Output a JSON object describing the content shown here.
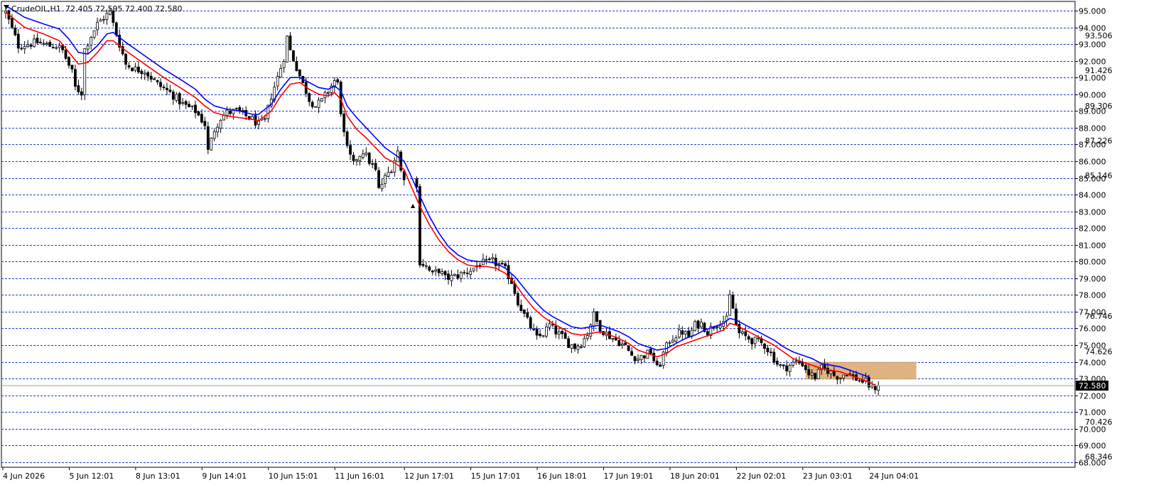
{
  "header": {
    "symbol_label": "CrudeOIL,H1",
    "ohlc_text": "72.405 72.595 72.400 72.580"
  },
  "current_price": {
    "value": 72.58,
    "label": "72.580"
  },
  "colors": {
    "background": "#ffffff",
    "grid": "#1f3fbf",
    "candle": "#000000",
    "ema_fast": "#ff0000",
    "ema_slow": "#0000ff",
    "zone_fill": "#d9a46b",
    "price_line": "#a0a0a0"
  },
  "chart_data": {
    "type": "candlestick",
    "symbol": "CrudeOIL",
    "timeframe": "H1",
    "y_axis": {
      "min": 67.7,
      "max": 95.55,
      "major_ticks": [
        95.0,
        94.0,
        93.0,
        92.0,
        91.0,
        90.0,
        89.0,
        88.0,
        87.0,
        86.0,
        85.0,
        84.0,
        83.0,
        82.0,
        81.0,
        80.0,
        79.0,
        78.0,
        77.0,
        76.0,
        75.0,
        74.0,
        73.0,
        72.0,
        71.0,
        70.0,
        69.0,
        68.0
      ],
      "major_labels": [
        "95.000",
        "94.000",
        "93.000",
        "92.000",
        "91.000",
        "90.000",
        "89.000",
        "88.000",
        "87.000",
        "86.000",
        "85.000",
        "84.000",
        "83.000",
        "82.000",
        "81.000",
        "80.000",
        "79.000",
        "78.000",
        "77.000",
        "76.000",
        "75.000",
        "74.000",
        "73.000",
        "72.000",
        "71.000",
        "70.000",
        "69.000",
        "68.000"
      ],
      "minor_labels": [
        {
          "value": 93.506,
          "label": "93.506"
        },
        {
          "value": 91.426,
          "label": "91.426"
        },
        {
          "value": 89.306,
          "label": "89.306"
        },
        {
          "value": 87.226,
          "label": "87.226"
        },
        {
          "value": 85.146,
          "label": "85.146"
        },
        {
          "value": 76.746,
          "label": "76.746"
        },
        {
          "value": 74.626,
          "label": "74.626"
        },
        {
          "value": 70.426,
          "label": "70.426"
        },
        {
          "value": 68.346,
          "label": "68.346"
        }
      ]
    },
    "x_axis": {
      "labels": [
        "4 Jun 2026",
        "5 Jun 12:01",
        "8 Jun 13:01",
        "9 Jun 14:01",
        "10 Jun 15:01",
        "11 Jun 16:01",
        "12 Jun 17:01",
        "15 Jun 17:01",
        "16 Jun 18:01",
        "17 Jun 19:01",
        "18 Jun 20:01",
        "22 Jun 02:01",
        "23 Jun 03:01",
        "24 Jun 04:01"
      ],
      "label_bars": [
        0,
        21,
        42,
        63,
        84,
        105,
        127,
        148,
        169,
        190,
        211,
        232,
        253,
        274
      ]
    },
    "price_path": [
      [
        0,
        94.9
      ],
      [
        4,
        92.9
      ],
      [
        7,
        93.0
      ],
      [
        10,
        93.1
      ],
      [
        14,
        92.9
      ],
      [
        16,
        92.9
      ],
      [
        18,
        92.6
      ],
      [
        21,
        91.3
      ],
      [
        22,
        90.4
      ],
      [
        24,
        90.1
      ],
      [
        25,
        92.7
      ],
      [
        27,
        93.5
      ],
      [
        29,
        94.2
      ],
      [
        31,
        94.6
      ],
      [
        33,
        94.9
      ],
      [
        34,
        94.2
      ],
      [
        35,
        93.6
      ],
      [
        38,
        91.8
      ],
      [
        41,
        91.5
      ],
      [
        44,
        91.4
      ],
      [
        48,
        90.6
      ],
      [
        52,
        90.1
      ],
      [
        56,
        89.4
      ],
      [
        60,
        89.0
      ],
      [
        63,
        88.2
      ],
      [
        64,
        86.6
      ],
      [
        66,
        87.9
      ],
      [
        68,
        88.6
      ],
      [
        70,
        88.9
      ],
      [
        73,
        89.0
      ],
      [
        75,
        88.8
      ],
      [
        78,
        88.5
      ],
      [
        80,
        88.2
      ],
      [
        82,
        88.4
      ],
      [
        84,
        89.9
      ],
      [
        86,
        91.0
      ],
      [
        88,
        92.2
      ],
      [
        89,
        93.4
      ],
      [
        90,
        92.6
      ],
      [
        92,
        91.6
      ],
      [
        94,
        90.6
      ],
      [
        95,
        90.2
      ],
      [
        96,
        89.7
      ],
      [
        98,
        89.3
      ],
      [
        100,
        89.6
      ],
      [
        102,
        90.2
      ],
      [
        104,
        90.8
      ],
      [
        105,
        90.6
      ],
      [
        106,
        89.0
      ],
      [
        107,
        87.6
      ],
      [
        108,
        86.7
      ],
      [
        110,
        85.8
      ],
      [
        111,
        86.2
      ],
      [
        113,
        86.6
      ],
      [
        115,
        86.0
      ],
      [
        117,
        85.4
      ],
      [
        118,
        84.3
      ],
      [
        120,
        85.0
      ],
      [
        122,
        85.6
      ],
      [
        124,
        86.6
      ],
      [
        125,
        85.4
      ],
      [
        127,
        84.8
      ],
      [
        130,
        84.4
      ],
      [
        131,
        80.0
      ],
      [
        133,
        79.7
      ],
      [
        135,
        79.2
      ],
      [
        137,
        79.5
      ],
      [
        139,
        79.0
      ],
      [
        142,
        79.1
      ],
      [
        145,
        79.3
      ],
      [
        148,
        79.6
      ],
      [
        150,
        79.9
      ],
      [
        152,
        79.9
      ],
      [
        154,
        80.0
      ],
      [
        156,
        79.8
      ],
      [
        158,
        79.5
      ],
      [
        160,
        78.8
      ],
      [
        162,
        77.6
      ],
      [
        164,
        76.8
      ],
      [
        166,
        76.1
      ],
      [
        168,
        75.4
      ],
      [
        170,
        75.7
      ],
      [
        172,
        76.2
      ],
      [
        174,
        75.8
      ],
      [
        176,
        75.5
      ],
      [
        178,
        75.1
      ],
      [
        180,
        74.9
      ],
      [
        182,
        75.1
      ],
      [
        184,
        75.7
      ],
      [
        185,
        76.3
      ],
      [
        186,
        76.8
      ],
      [
        188,
        76.0
      ],
      [
        190,
        75.7
      ],
      [
        192,
        75.4
      ],
      [
        194,
        75.2
      ],
      [
        196,
        74.9
      ],
      [
        198,
        74.4
      ],
      [
        200,
        74.2
      ],
      [
        202,
        74.4
      ],
      [
        204,
        74.6
      ],
      [
        206,
        73.6
      ],
      [
        207,
        73.9
      ],
      [
        208,
        74.5
      ],
      [
        210,
        75.3
      ],
      [
        212,
        75.6
      ],
      [
        214,
        75.8
      ],
      [
        216,
        75.5
      ],
      [
        218,
        76.2
      ],
      [
        220,
        76.3
      ],
      [
        222,
        75.8
      ],
      [
        224,
        76.2
      ],
      [
        226,
        76.4
      ],
      [
        228,
        76.5
      ],
      [
        229,
        77.9
      ],
      [
        230,
        77.2
      ],
      [
        231,
        76.2
      ],
      [
        232,
        75.7
      ],
      [
        234,
        75.5
      ],
      [
        236,
        75.3
      ],
      [
        238,
        75.2
      ],
      [
        240,
        75.0
      ],
      [
        242,
        74.5
      ],
      [
        244,
        73.9
      ],
      [
        246,
        73.6
      ],
      [
        248,
        73.8
      ],
      [
        250,
        74.0
      ],
      [
        252,
        73.9
      ],
      [
        254,
        73.3
      ],
      [
        256,
        73.1
      ],
      [
        258,
        73.6
      ],
      [
        260,
        73.5
      ],
      [
        262,
        73.2
      ],
      [
        264,
        73.1
      ],
      [
        266,
        73.4
      ],
      [
        268,
        73.1
      ],
      [
        270,
        72.9
      ],
      [
        272,
        72.8
      ],
      [
        274,
        72.4
      ],
      [
        276,
        72.58
      ]
    ],
    "gaps": [
      {
        "from_bar": 126,
        "to_bar": 130
      }
    ],
    "series": [
      {
        "name": "",
        "type": "ema_line",
        "color": "red",
        "points": [
          [
            0,
            94.9
          ],
          [
            6,
            94.0
          ],
          [
            12,
            93.6
          ],
          [
            17,
            93.2
          ],
          [
            20,
            92.5
          ],
          [
            23,
            91.8
          ],
          [
            26,
            91.9
          ],
          [
            29,
            92.5
          ],
          [
            32,
            93.2
          ],
          [
            34,
            93.2
          ],
          [
            38,
            92.6
          ],
          [
            44,
            91.8
          ],
          [
            50,
            91.0
          ],
          [
            56,
            90.3
          ],
          [
            60,
            89.8
          ],
          [
            63,
            89.3
          ],
          [
            66,
            88.9
          ],
          [
            70,
            88.7
          ],
          [
            74,
            88.6
          ],
          [
            78,
            88.5
          ],
          [
            80,
            88.4
          ],
          [
            84,
            89.0
          ],
          [
            87,
            89.9
          ],
          [
            90,
            90.6
          ],
          [
            93,
            90.7
          ],
          [
            96,
            90.3
          ],
          [
            99,
            90.0
          ],
          [
            102,
            89.9
          ],
          [
            104,
            90.1
          ],
          [
            106,
            89.7
          ],
          [
            108,
            88.7
          ],
          [
            111,
            87.9
          ],
          [
            114,
            87.4
          ],
          [
            117,
            86.8
          ],
          [
            120,
            86.2
          ],
          [
            123,
            85.9
          ],
          [
            126,
            85.5
          ],
          [
            128,
            84.6
          ],
          [
            131,
            83.3
          ],
          [
            134,
            82.2
          ],
          [
            137,
            81.3
          ],
          [
            140,
            80.6
          ],
          [
            143,
            80.1
          ],
          [
            146,
            79.8
          ],
          [
            149,
            79.7
          ],
          [
            152,
            79.7
          ],
          [
            155,
            79.6
          ],
          [
            158,
            79.3
          ],
          [
            161,
            78.7
          ],
          [
            164,
            77.9
          ],
          [
            167,
            77.2
          ],
          [
            170,
            76.7
          ],
          [
            173,
            76.3
          ],
          [
            176,
            76.0
          ],
          [
            179,
            75.7
          ],
          [
            182,
            75.6
          ],
          [
            185,
            75.7
          ],
          [
            188,
            75.8
          ],
          [
            191,
            75.6
          ],
          [
            194,
            75.4
          ],
          [
            197,
            75.1
          ],
          [
            200,
            74.7
          ],
          [
            203,
            74.5
          ],
          [
            206,
            74.3
          ],
          [
            209,
            74.5
          ],
          [
            212,
            74.9
          ],
          [
            215,
            75.1
          ],
          [
            218,
            75.3
          ],
          [
            221,
            75.5
          ],
          [
            224,
            75.7
          ],
          [
            227,
            75.9
          ],
          [
            229,
            76.3
          ],
          [
            231,
            76.2
          ],
          [
            234,
            75.9
          ],
          [
            237,
            75.6
          ],
          [
            240,
            75.3
          ],
          [
            243,
            75.0
          ],
          [
            246,
            74.6
          ],
          [
            249,
            74.2
          ],
          [
            252,
            74.0
          ],
          [
            255,
            73.8
          ],
          [
            258,
            73.6
          ],
          [
            261,
            73.5
          ],
          [
            264,
            73.4
          ],
          [
            267,
            73.2
          ],
          [
            270,
            73.0
          ],
          [
            273,
            72.8
          ],
          [
            275,
            72.6
          ]
        ]
      },
      {
        "name": "",
        "type": "ema_line",
        "color": "blue",
        "points": [
          [
            0,
            95.3
          ],
          [
            6,
            94.6
          ],
          [
            12,
            94.2
          ],
          [
            17,
            93.9
          ],
          [
            20,
            93.3
          ],
          [
            23,
            92.5
          ],
          [
            26,
            92.4
          ],
          [
            29,
            92.9
          ],
          [
            32,
            93.6
          ],
          [
            34,
            93.7
          ],
          [
            38,
            93.1
          ],
          [
            44,
            92.3
          ],
          [
            50,
            91.5
          ],
          [
            56,
            90.8
          ],
          [
            60,
            90.3
          ],
          [
            63,
            89.7
          ],
          [
            66,
            89.3
          ],
          [
            70,
            89.1
          ],
          [
            74,
            89.0
          ],
          [
            78,
            88.8
          ],
          [
            80,
            88.8
          ],
          [
            84,
            89.4
          ],
          [
            87,
            90.3
          ],
          [
            90,
            91.0
          ],
          [
            93,
            91.0
          ],
          [
            96,
            90.7
          ],
          [
            99,
            90.4
          ],
          [
            102,
            90.3
          ],
          [
            104,
            90.5
          ],
          [
            106,
            90.2
          ],
          [
            108,
            89.3
          ],
          [
            111,
            88.6
          ],
          [
            114,
            88.0
          ],
          [
            117,
            87.4
          ],
          [
            120,
            86.8
          ],
          [
            123,
            86.4
          ],
          [
            126,
            86.0
          ],
          [
            128,
            85.2
          ],
          [
            131,
            83.9
          ],
          [
            134,
            82.7
          ],
          [
            137,
            81.7
          ],
          [
            140,
            80.9
          ],
          [
            143,
            80.4
          ],
          [
            146,
            80.1
          ],
          [
            149,
            80.0
          ],
          [
            152,
            80.0
          ],
          [
            155,
            79.9
          ],
          [
            158,
            79.6
          ],
          [
            161,
            79.1
          ],
          [
            164,
            78.4
          ],
          [
            167,
            77.7
          ],
          [
            170,
            77.1
          ],
          [
            173,
            76.7
          ],
          [
            176,
            76.4
          ],
          [
            179,
            76.1
          ],
          [
            182,
            76.0
          ],
          [
            185,
            76.1
          ],
          [
            188,
            76.2
          ],
          [
            191,
            76.0
          ],
          [
            194,
            75.8
          ],
          [
            197,
            75.5
          ],
          [
            200,
            75.1
          ],
          [
            203,
            74.9
          ],
          [
            206,
            74.7
          ],
          [
            209,
            74.8
          ],
          [
            212,
            75.1
          ],
          [
            215,
            75.4
          ],
          [
            218,
            75.6
          ],
          [
            221,
            75.9
          ],
          [
            224,
            76.1
          ],
          [
            227,
            76.3
          ],
          [
            229,
            76.6
          ],
          [
            231,
            76.5
          ],
          [
            234,
            76.2
          ],
          [
            237,
            75.9
          ],
          [
            240,
            75.6
          ],
          [
            243,
            75.3
          ],
          [
            246,
            74.9
          ],
          [
            249,
            74.6
          ],
          [
            252,
            74.4
          ],
          [
            255,
            74.2
          ],
          [
            258,
            73.9
          ],
          [
            261,
            73.8
          ],
          [
            264,
            73.7
          ],
          [
            267,
            73.5
          ],
          [
            270,
            73.3
          ],
          [
            273,
            73.1
          ]
        ]
      }
    ],
    "zone": {
      "from_bar": 253,
      "to_bar": 288,
      "low": 72.95,
      "high": 74.0
    },
    "last_bar": 276,
    "grid": true,
    "grid_style": "dashed"
  }
}
